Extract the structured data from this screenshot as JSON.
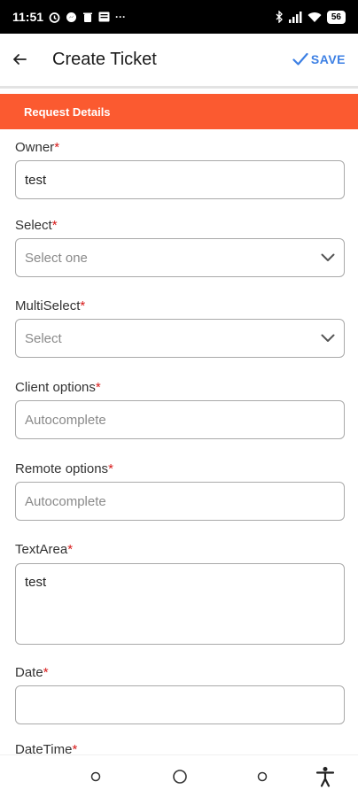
{
  "status_bar": {
    "time": "11:51",
    "left_icons": [
      "alarm-icon",
      "messenger-icon",
      "trash-icon",
      "news-icon",
      "more-dots-icon"
    ],
    "more": "···",
    "battery": "56"
  },
  "app_bar": {
    "title": "Create Ticket",
    "save_label": "SAVE",
    "accent": "#3d80e4"
  },
  "section": {
    "title": "Request Details",
    "color": "#fb5a30"
  },
  "form": {
    "required_marker": "*",
    "fields": [
      {
        "label": "Owner",
        "value": "test",
        "placeholder": ""
      },
      {
        "label": "Select",
        "value": "",
        "placeholder": "Select one"
      },
      {
        "label": "MultiSelect",
        "value": "",
        "placeholder": "Select"
      },
      {
        "label": "Client options",
        "value": "",
        "placeholder": "Autocomplete"
      },
      {
        "label": "Remote options",
        "value": "",
        "placeholder": "Autocomplete"
      },
      {
        "label": "TextArea",
        "value": "test",
        "placeholder": ""
      },
      {
        "label": "Date",
        "value": "",
        "placeholder": ""
      },
      {
        "label": "DateTime",
        "value": "",
        "placeholder": ""
      }
    ]
  },
  "nav_bar": {
    "icons": [
      "recent-apps-icon",
      "home-icon",
      "back-nav-icon",
      "accessibility-icon"
    ]
  }
}
